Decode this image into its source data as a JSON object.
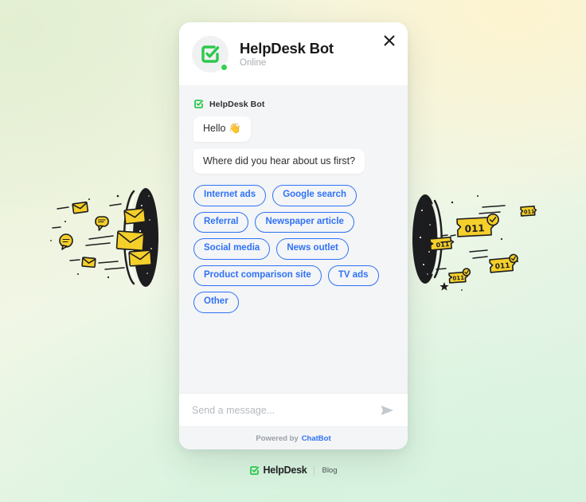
{
  "theme": {
    "accent_blue": "#2f72f5",
    "brand_green": "#36cf4f",
    "widget_bg": "#f4f5f7",
    "envelope_yellow": "#f5cf2a",
    "background_top_left": "#eaf3da",
    "background_top_right": "#fdf3cf",
    "background_bottom": "#d9f2e0"
  },
  "widget": {
    "header": {
      "bot_name": "HelpDesk Bot",
      "status": "Online",
      "avatar_icon": "helpdesk-check-icon",
      "close_icon": "close-icon"
    },
    "conversation": {
      "sender_label": "HelpDesk Bot",
      "sender_icon": "helpdesk-check-icon",
      "messages": [
        {
          "text": "Hello 👋"
        },
        {
          "text": "Where did you hear about us first?"
        }
      ],
      "quick_replies": [
        "Internet ads",
        "Google search",
        "Referral",
        "Newspaper article",
        "Social media",
        "News outlet",
        "Product comparison site",
        "TV ads",
        "Other"
      ]
    },
    "compose": {
      "placeholder": "Send a message...",
      "value": "",
      "send_icon": "send-icon"
    },
    "footer": {
      "powered_by": "Powered by",
      "brand": "ChatBot"
    }
  },
  "page_footer": {
    "logo_icon": "helpdesk-check-icon",
    "brand": "HelpDesk",
    "blog_label": "Blog"
  },
  "decorations": {
    "left": {
      "name": "portal-with-envelopes-illustration",
      "description": "Dark portal ellipse with yellow envelopes and chat bubbles flying out"
    },
    "right": {
      "name": "portal-with-tickets-illustration",
      "description": "Dark portal ellipse with yellow ticket tags labeled 011 flying out"
    }
  }
}
